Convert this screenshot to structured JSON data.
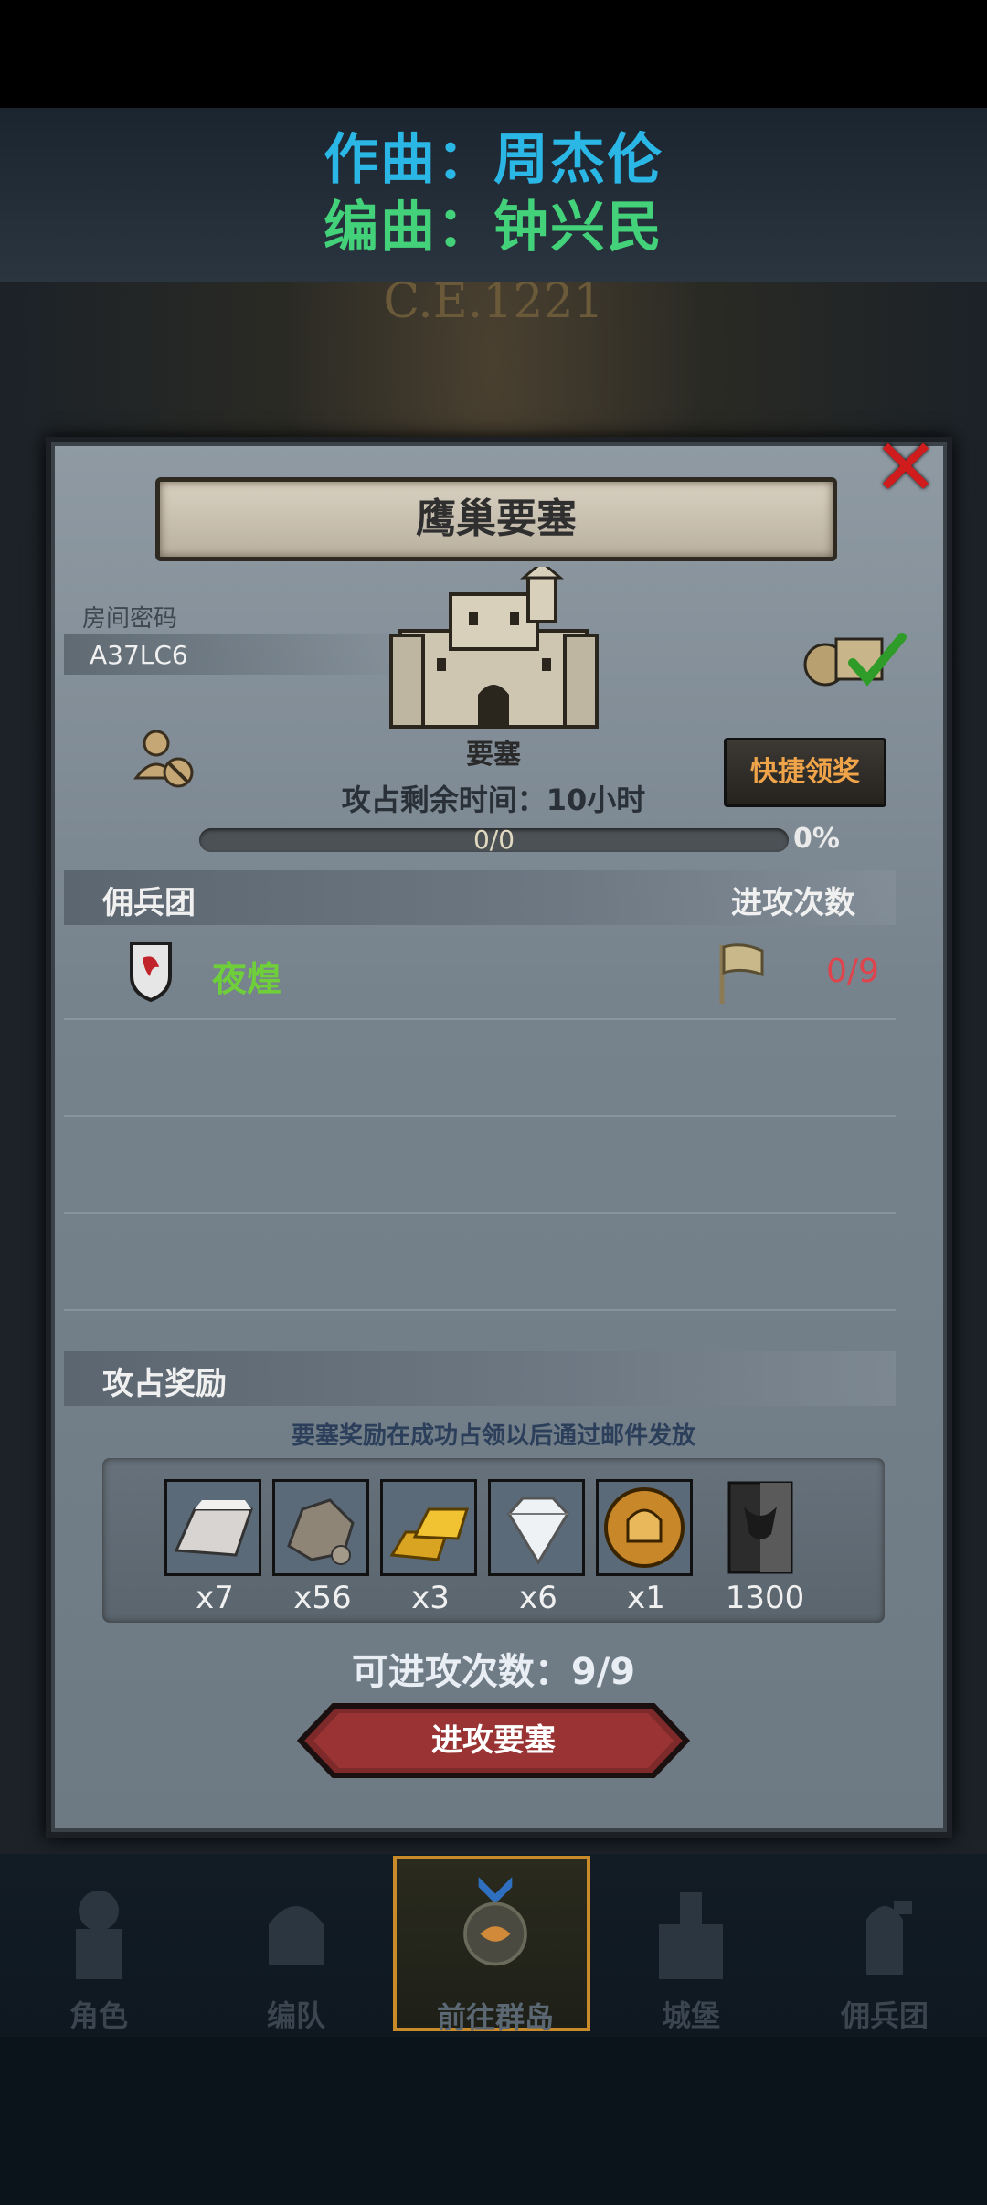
{
  "lyrics": {
    "line1": "作曲：周杰伦",
    "line2": "编曲：钟兴民"
  },
  "background": {
    "year": "C.E.1221"
  },
  "dialog": {
    "title": "鹰巢要塞",
    "room_code_label": "房间密码",
    "room_code": "A37LC6",
    "fortress_label": "要塞",
    "quick_claim": "快捷领奖",
    "time_remaining": "攻占剩余时间：10小时",
    "progress": {
      "text": "0/0",
      "percent": "0%",
      "fraction": 0
    },
    "mercenary_header": "佣兵团",
    "attacks_header": "进攻次数",
    "guild": {
      "name": "夜煌",
      "attacks": "0/9"
    },
    "rewards_header": "攻占奖励",
    "reward_note": "要塞奖励在成功占领以后通过邮件发放",
    "rewards": [
      {
        "icon": "iron-ingot-icon",
        "qty": "x7"
      },
      {
        "icon": "stone-ore-icon",
        "qty": "x56"
      },
      {
        "icon": "gold-bars-icon",
        "qty": "x3"
      },
      {
        "icon": "diamond-icon",
        "qty": "x6"
      },
      {
        "icon": "knight-medal-icon",
        "qty": "x1"
      },
      {
        "icon": "bull-banner-icon",
        "qty": "1300"
      }
    ],
    "available_attacks": "可进攻次数：9/9",
    "attack_button": "进攻要塞"
  },
  "nav": [
    {
      "label": "角色",
      "icon": "knight-icon"
    },
    {
      "label": "编队",
      "icon": "helmet-icon"
    },
    {
      "label": "前往群岛",
      "icon": "compass-icon"
    },
    {
      "label": "城堡",
      "icon": "castle-icon"
    },
    {
      "label": "佣兵团",
      "icon": "mercenary-icon"
    }
  ],
  "colors": {
    "close": "#d01c1c",
    "guild_name": "#6fcf3a",
    "attacks": "#e0434b",
    "quick_claim_text": "#f0a44a",
    "nav_active_border": "#c98a2a"
  }
}
